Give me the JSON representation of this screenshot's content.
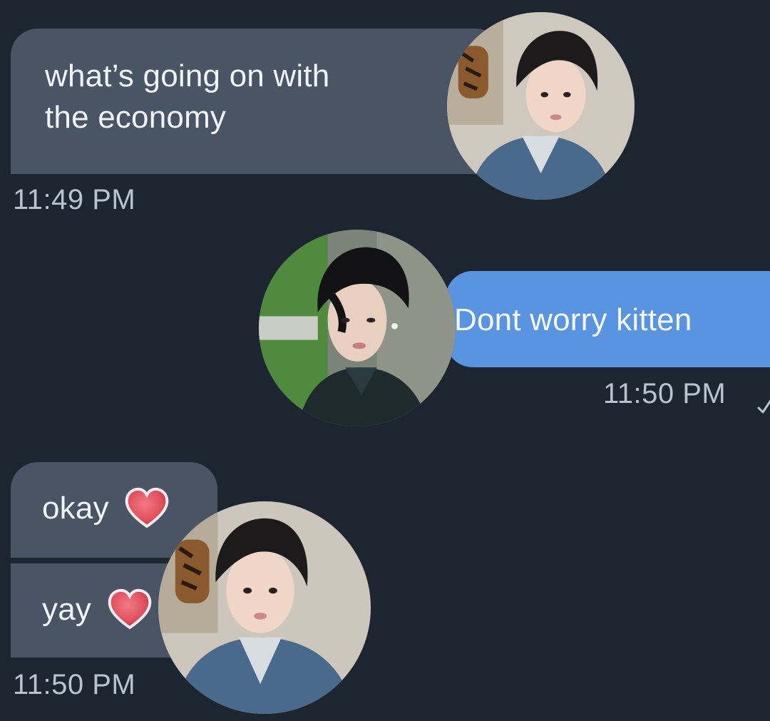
{
  "messages": [
    {
      "direction": "incoming",
      "text": "what’s going on with\nthe economy"
    },
    {
      "direction": "outgoing",
      "text": "Dont worry kitten"
    },
    {
      "direction": "incoming",
      "text": "okay",
      "icon": "red-heart-icon"
    },
    {
      "direction": "incoming",
      "text": "yay",
      "icon": "red-heart-icon"
    }
  ],
  "timestamps": {
    "first": "11:49 PM",
    "second": "11:50 PM",
    "third": "11:50 PM"
  },
  "avatars": [
    {
      "name": "profile-photo-denim-jacket"
    },
    {
      "name": "profile-photo-dark-jacket"
    },
    {
      "name": "profile-photo-denim-jacket"
    }
  ],
  "colors": {
    "background": "#1d2630",
    "incoming_bubble": "#495564",
    "outgoing_bubble": "#5a93df",
    "timestamp_text": "#b9c3cf",
    "heart": "#e0505c"
  },
  "icons": {
    "read_receipt": "check-icon",
    "heart": "red-heart-icon"
  }
}
